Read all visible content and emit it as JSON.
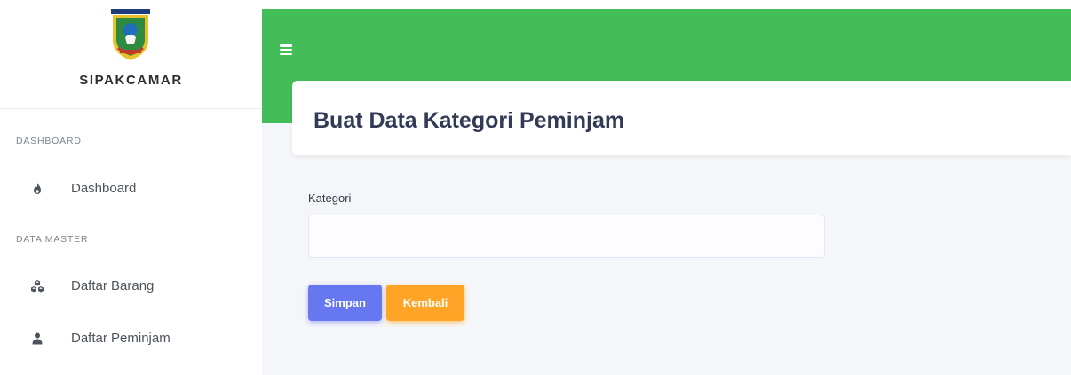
{
  "brand": {
    "name": "SIPAKCAMAR",
    "logo_icon": "province-emblem-icon"
  },
  "sidebar": {
    "sections": [
      {
        "label": "DASHBOARD",
        "items": [
          {
            "label": "Dashboard",
            "icon": "fire-icon"
          }
        ]
      },
      {
        "label": "DATA MASTER",
        "items": [
          {
            "label": "Daftar Barang",
            "icon": "cubes-icon"
          },
          {
            "label": "Daftar Peminjam",
            "icon": "user-icon"
          }
        ]
      }
    ]
  },
  "header": {
    "menu_icon": "hamburger-icon",
    "title": "Buat Data Kategori Peminjam"
  },
  "form": {
    "kategori_label": "Kategori",
    "kategori_value": "",
    "submit_label": "Simpan",
    "back_label": "Kembali"
  },
  "colors": {
    "header_green": "#43bd57",
    "primary": "#6777ef",
    "warning": "#ffa426",
    "title_text": "#323a56"
  }
}
